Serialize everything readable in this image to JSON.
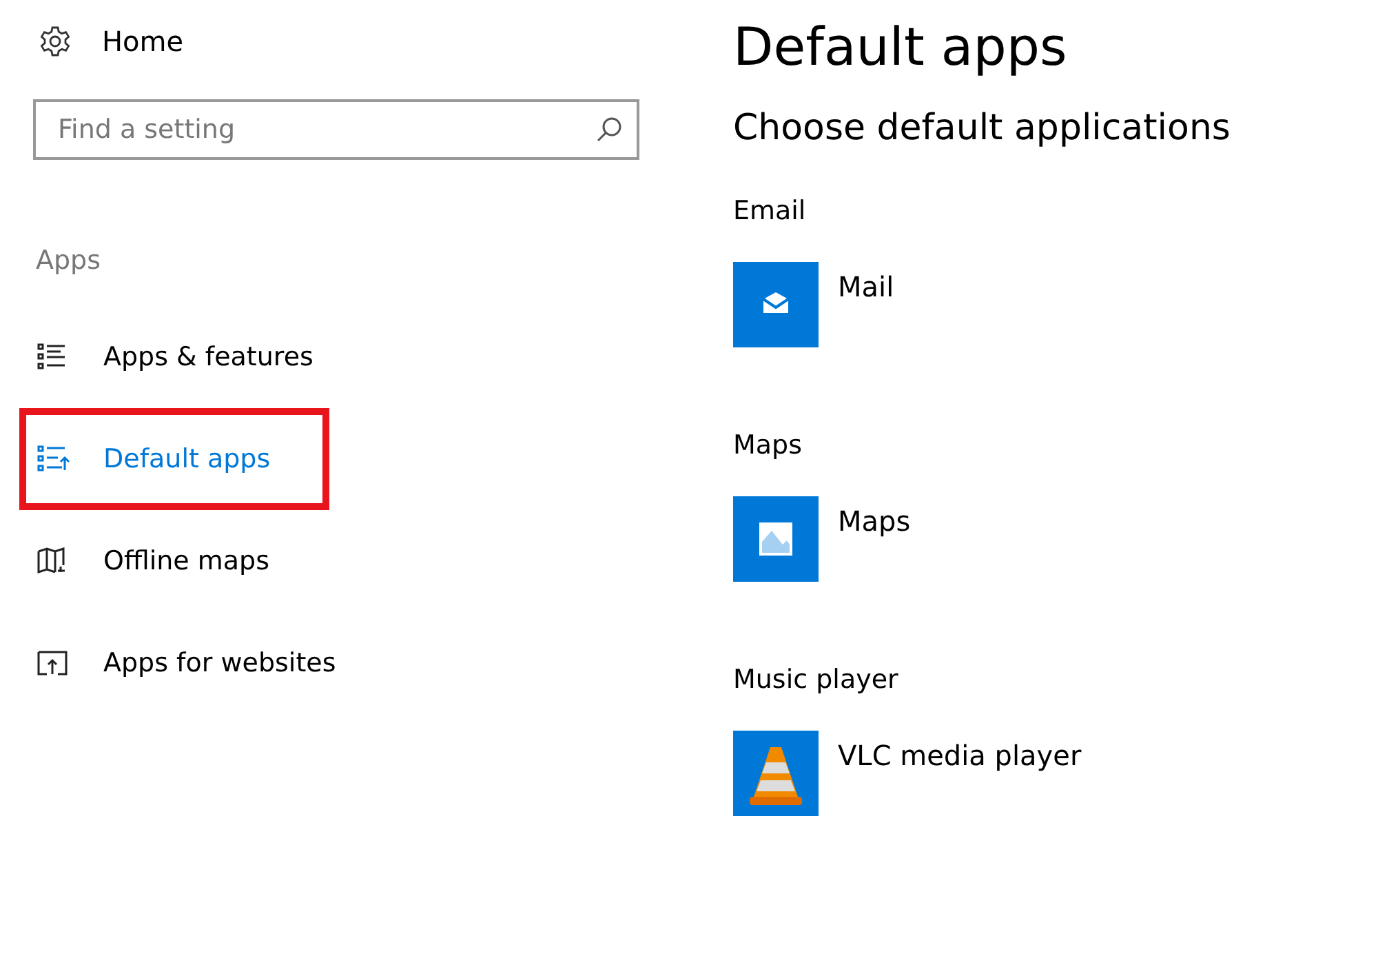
{
  "sidebar": {
    "home": {
      "label": "Home"
    },
    "search": {
      "placeholder": "Find a setting"
    },
    "section": "Apps",
    "items": [
      {
        "label": "Apps & features",
        "kind": "list",
        "selected": false,
        "highlighted": false
      },
      {
        "label": "Default apps",
        "kind": "defaults",
        "selected": true,
        "highlighted": true
      },
      {
        "label": "Offline maps",
        "kind": "map",
        "selected": false,
        "highlighted": false
      },
      {
        "label": "Apps for websites",
        "kind": "website",
        "selected": false,
        "highlighted": false
      }
    ]
  },
  "main": {
    "title": "Default apps",
    "subtitle": "Choose default applications",
    "groups": [
      {
        "heading": "Email",
        "app": "Mail",
        "kind": "mail"
      },
      {
        "heading": "Maps",
        "app": "Maps",
        "kind": "maps"
      },
      {
        "heading": "Music player",
        "app": "VLC media player",
        "kind": "vlc"
      }
    ]
  }
}
